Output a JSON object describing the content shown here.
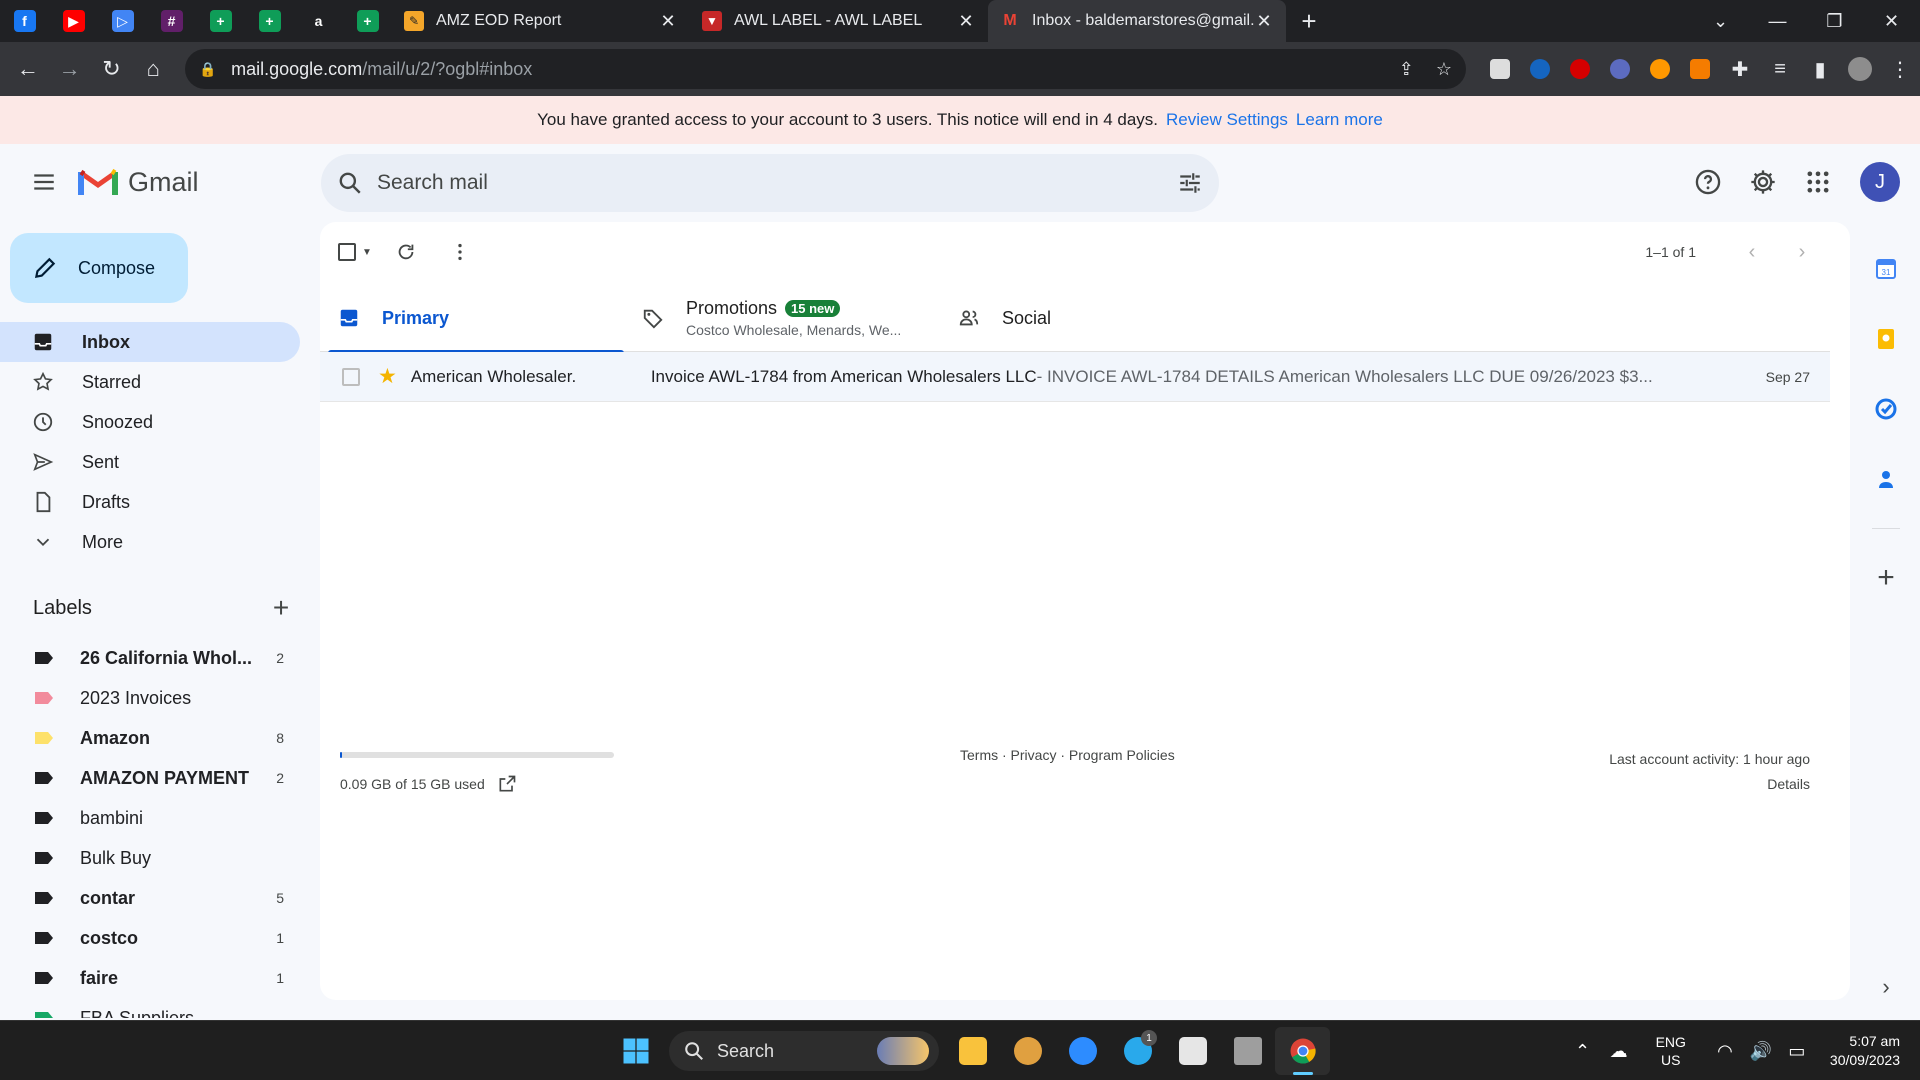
{
  "browser": {
    "pinned_tabs": [
      {
        "icon": "facebook-icon",
        "color": "#1877f2",
        "glyph": "f"
      },
      {
        "icon": "youtube-icon",
        "color": "#ff0000",
        "glyph": "▶"
      },
      {
        "icon": "play-icon",
        "color": "#4285f4",
        "glyph": "▷"
      },
      {
        "icon": "slack-icon",
        "color": "#611f69",
        "glyph": "#"
      },
      {
        "icon": "sheets-icon",
        "color": "#0f9d58",
        "glyph": "+"
      },
      {
        "icon": "sheets-icon",
        "color": "#0f9d58",
        "glyph": "+"
      },
      {
        "icon": "amazon-icon",
        "color": "#202124",
        "glyph": "a"
      },
      {
        "icon": "sheets-icon",
        "color": "#0f9d58",
        "glyph": "+"
      }
    ],
    "tabs": [
      {
        "title": "AMZ EOD Report",
        "active": false
      },
      {
        "title": "AWL LABEL - AWL LABEL",
        "active": false
      },
      {
        "title": "Inbox - baldemarstores@gmail.c",
        "active": true
      }
    ],
    "url_host": "mail.google.com",
    "url_path": "/mail/u/2/?ogbl#inbox"
  },
  "notice": {
    "text": "You have granted access to your account to 3 users. This notice will end in 4 days.",
    "review_link": "Review Settings",
    "learn_link": "Learn more"
  },
  "gmail": {
    "logo_text": "Gmail",
    "search_placeholder": "Search mail",
    "avatar_letter": "J",
    "compose_label": "Compose",
    "nav": [
      {
        "label": "Inbox",
        "icon": "inbox-icon",
        "active": true
      },
      {
        "label": "Starred",
        "icon": "star-icon",
        "active": false
      },
      {
        "label": "Snoozed",
        "icon": "clock-icon",
        "active": false
      },
      {
        "label": "Sent",
        "icon": "send-icon",
        "active": false
      },
      {
        "label": "Drafts",
        "icon": "draft-icon",
        "active": false
      },
      {
        "label": "More",
        "icon": "chevron-down-icon",
        "active": false
      }
    ],
    "labels_title": "Labels",
    "labels": [
      {
        "name": "26 California Whol...",
        "count": "2",
        "color": "#202124",
        "bold": true
      },
      {
        "name": "2023 Invoices",
        "count": "",
        "color": "#f28b9c",
        "bold": false
      },
      {
        "name": "Amazon",
        "count": "8",
        "color": "#fde16a",
        "bold": true
      },
      {
        "name": "AMAZON PAYMENT",
        "count": "2",
        "color": "#202124",
        "bold": true
      },
      {
        "name": "bambini",
        "count": "",
        "color": "#202124",
        "bold": false
      },
      {
        "name": "Bulk Buy",
        "count": "",
        "color": "#202124",
        "bold": false
      },
      {
        "name": "contar",
        "count": "5",
        "color": "#202124",
        "bold": true
      },
      {
        "name": "costco",
        "count": "1",
        "color": "#202124",
        "bold": true
      },
      {
        "name": "faire",
        "count": "1",
        "color": "#202124",
        "bold": true
      },
      {
        "name": "FBA Suppliers",
        "count": "",
        "color": "#16a765",
        "bold": false
      }
    ],
    "pager_text": "1–1 of 1",
    "tabs": {
      "primary": "Primary",
      "promotions": "Promotions",
      "promotions_badge": "15 new",
      "promotions_sub": "Costco Wholesale, Menards, We...",
      "social": "Social"
    },
    "email": {
      "sender": "American Wholesaler.",
      "subject": "Invoice AWL-1784 from American Wholesalers LLC",
      "snippet": " - INVOICE AWL-1784 DETAILS American Wholesalers LLC DUE 09/26/2023 $3...",
      "date": "Sep 27",
      "starred": true
    },
    "footer": {
      "storage_text": "0.09 GB of 15 GB used",
      "storage_fraction": 0.006,
      "links": "Terms · Privacy · Program Policies",
      "activity": "Last account activity: 1 hour ago",
      "details": "Details"
    }
  },
  "taskbar": {
    "search_label": "Search",
    "telegram_badge": "1",
    "lang_top": "ENG",
    "lang_bottom": "US",
    "time": "5:07 am",
    "date": "30/09/2023"
  }
}
